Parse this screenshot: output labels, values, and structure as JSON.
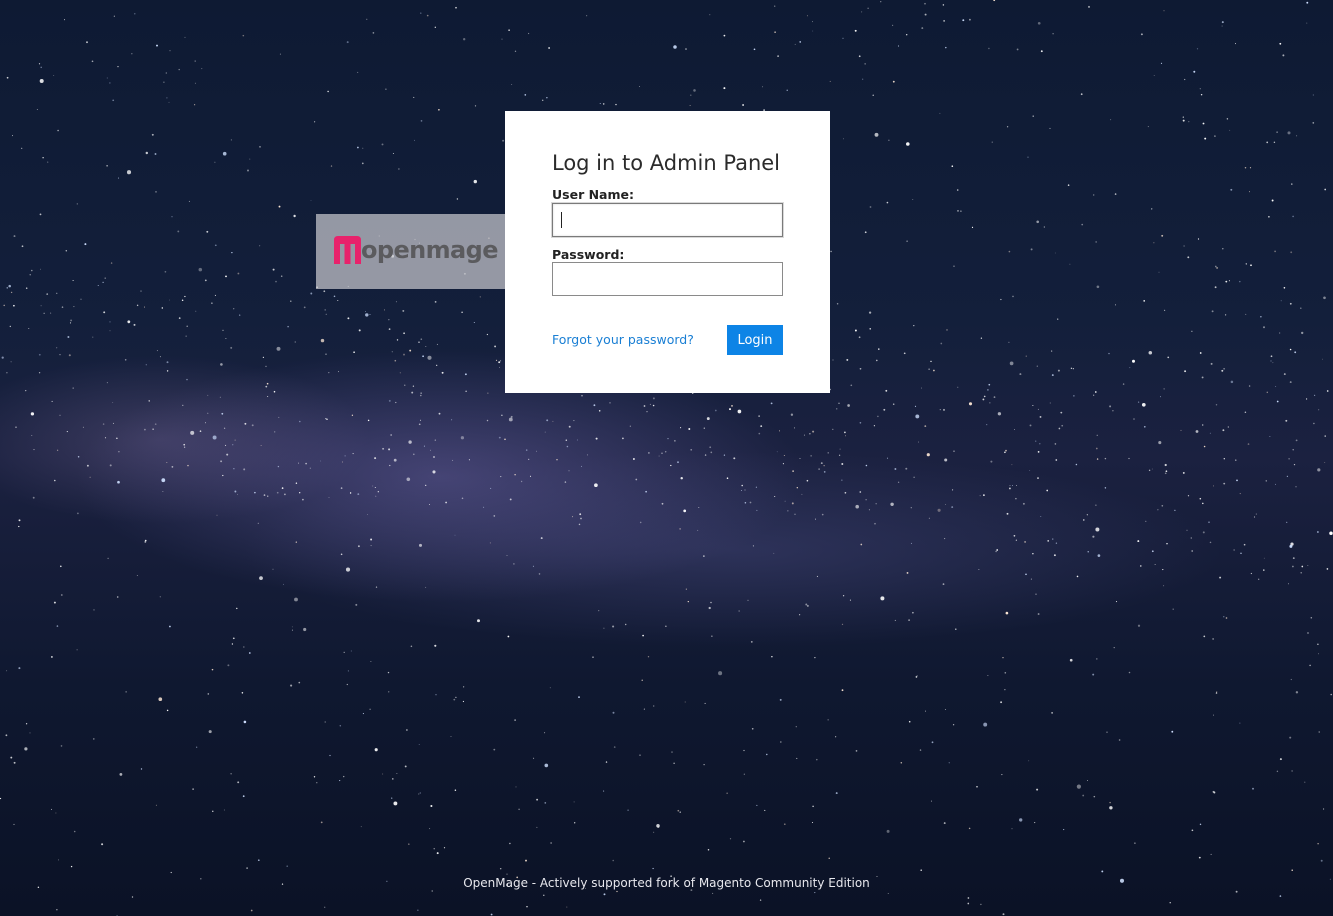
{
  "logo": {
    "text": "openmage",
    "mark_color": "#e8226b",
    "icon": "openmage-m-icon"
  },
  "login": {
    "title": "Log in to Admin Panel",
    "username_label": "User Name:",
    "username_value": "",
    "password_label": "Password:",
    "password_value": "",
    "forgot_link": "Forgot your password?",
    "login_button": "Login"
  },
  "footer": {
    "text": "OpenMage - Actively supported fork of Magento Community Edition"
  },
  "colors": {
    "accent": "#0d84e6",
    "link": "#1a7fd4",
    "background": "#131f3b"
  }
}
